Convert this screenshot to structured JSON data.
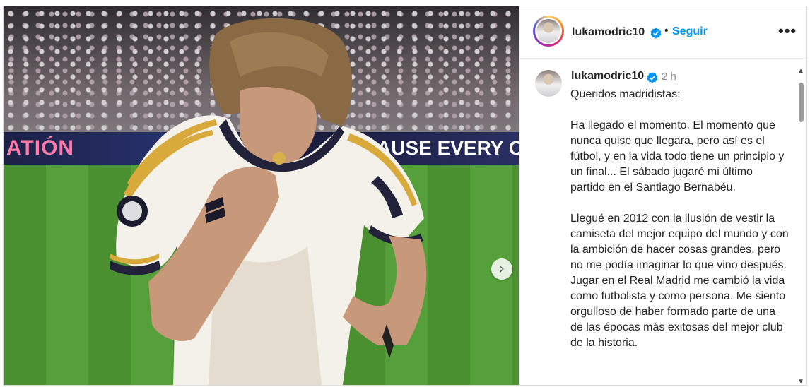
{
  "post": {
    "username": "lukamodric10",
    "follow_label": "Seguir",
    "separator": "•",
    "more_label": "•••",
    "time": "2 h"
  },
  "photo": {
    "ad_left_text": "ATIÓN",
    "ad_right_text": "AUSE EVERY CH",
    "next_label": "›"
  },
  "caption": {
    "text": "Queridos madridistas:\n\nHa llegado el momento. El momento que nunca quise que llegara, pero así es el fútbol, y en la vida todo tiene un principio y un final... El sábado jugaré mi último partido en el Santiago Bernabéu.\n\nLlegué en 2012 con la ilusión de vestir la camiseta del mejor equipo del mundo y con la ambición de hacer cosas grandes, pero no me podía imaginar lo que vino después.\nJugar en el Real Madrid me cambió la vida como futbolista y como persona. Me siento orgulloso de haber formado parte de una de las épocas más exitosas del mejor club de la historia."
  },
  "icons": {
    "verified": "verified-badge-icon",
    "more": "more-options-icon",
    "next": "chevron-right-icon"
  },
  "colors": {
    "follow": "#0095f6",
    "verified": "#0095f6",
    "muted": "#8e8e8e"
  }
}
